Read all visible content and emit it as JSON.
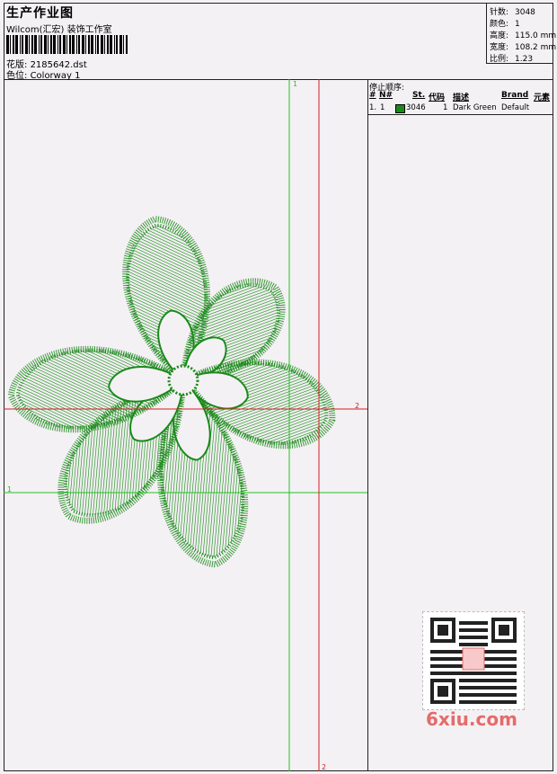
{
  "header": {
    "title": "生产作业图",
    "subtitle": "Wilcom(汇宏) 装饰工作室",
    "design_label": "花版:",
    "design_value": "2185642.dst",
    "colorway_label": "色位:",
    "colorway_value": "Colorway 1"
  },
  "stats": {
    "stitches_label": "针数:",
    "stitches_value": "3048",
    "colors_label": "颜色:",
    "colors_value": "1",
    "height_label": "高度:",
    "height_value": "115.0 mm",
    "width_label": "宽度:",
    "width_value": "108.2 mm",
    "scale_label": "比例:",
    "scale_value": "1.23"
  },
  "stop_sequence": {
    "title": "停止顺序:",
    "columns": [
      "#",
      "N#",
      "St.",
      "代码",
      "描述",
      "Brand",
      "元素"
    ],
    "rows": [
      {
        "index": "1.",
        "needle": "1",
        "stitches": "3046",
        "code": "1",
        "description": "Dark Green",
        "brand": "Default"
      }
    ]
  },
  "guides": {
    "green_top": "1",
    "green_left": "1",
    "red_right": "2",
    "red_bottom": "2"
  },
  "watermark": "6xiu.com",
  "colors": {
    "thread": "#1a8a1a",
    "guide_green": "#22c422",
    "guide_red": "#d42020",
    "background": "#f4f1f4"
  }
}
